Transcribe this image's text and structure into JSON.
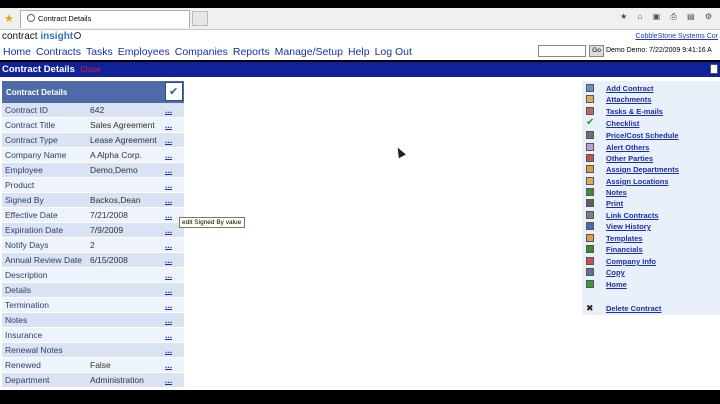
{
  "browser": {
    "tab_title": "Contract Details"
  },
  "header": {
    "brand_part1": "contract",
    "brand_part2": "insight",
    "company_link": "CobbleStone Systems Cor"
  },
  "nav": {
    "items": [
      "Home",
      "Contracts",
      "Tasks",
      "Employees",
      "Companies",
      "Reports",
      "Manage/Setup",
      "Help",
      "Log Out"
    ],
    "go_label": "Go",
    "search_placeholder": "",
    "demo_info": "Demo Demo: 7/22/2009 9:41:16 A"
  },
  "page": {
    "title": "Contract Details",
    "close_label": "Close"
  },
  "details": {
    "header": "Contract Details",
    "rows": [
      {
        "label": "Contract ID",
        "value": "642"
      },
      {
        "label": "Contract Title",
        "value": "Sales Agreement"
      },
      {
        "label": "Contract Type",
        "value": "Lease Agreement"
      },
      {
        "label": "Company Name",
        "value": "A Alpha Corp."
      },
      {
        "label": "Employee",
        "value": "Demo,Demo"
      },
      {
        "label": "Product",
        "value": ""
      },
      {
        "label": "Signed By",
        "value": "Backos,Dean"
      },
      {
        "label": "Effective Date",
        "value": "7/21/2008"
      },
      {
        "label": "Expiration Date",
        "value": "7/9/2009"
      },
      {
        "label": "Notify Days",
        "value": "2"
      },
      {
        "label": "Annual Review Date",
        "value": "6/15/2008"
      },
      {
        "label": "Description",
        "value": ""
      },
      {
        "label": "Details",
        "value": ""
      },
      {
        "label": "Termination",
        "value": ""
      },
      {
        "label": "Notes",
        "value": ""
      },
      {
        "label": "Insurance",
        "value": ""
      },
      {
        "label": "Renewal Notes",
        "value": ""
      },
      {
        "label": "Renewed",
        "value": "False"
      },
      {
        "label": "Department",
        "value": "Administration"
      }
    ],
    "edit_dots": "...",
    "tooltip": "edit Signed By value"
  },
  "actions": {
    "items": [
      {
        "label": "Add Contract",
        "icon": "add-document-icon",
        "color": "#6b8cc8"
      },
      {
        "label": "Attachments",
        "icon": "paperclip-icon",
        "color": "#d8b060"
      },
      {
        "label": "Tasks & E-mails",
        "icon": "task-icon",
        "color": "#c86060"
      },
      {
        "label": "Checklist",
        "icon": "checkmark-icon",
        "color": "#2a9a2a"
      },
      {
        "label": "Price/Cost Schedule",
        "icon": "calculator-icon",
        "color": "#707070"
      },
      {
        "label": "Alert Others",
        "icon": "alert-icon",
        "color": "#c0a0d0"
      },
      {
        "label": "Other Parties",
        "icon": "people-icon",
        "color": "#c85050"
      },
      {
        "label": "Assign Departments",
        "icon": "pencil-icon",
        "color": "#d8a040"
      },
      {
        "label": "Assign Locations",
        "icon": "folder-icon",
        "color": "#e0b050"
      },
      {
        "label": "Notes",
        "icon": "note-icon",
        "color": "#3a8a3a"
      },
      {
        "label": "Print",
        "icon": "printer-icon",
        "color": "#606060"
      },
      {
        "label": "Link Contracts",
        "icon": "link-icon",
        "color": "#808080"
      },
      {
        "label": "View History",
        "icon": "history-icon",
        "color": "#4a6ab0"
      },
      {
        "label": "Templates",
        "icon": "template-icon",
        "color": "#e0a040"
      },
      {
        "label": "Financials",
        "icon": "financials-icon",
        "color": "#3a8a3a"
      },
      {
        "label": "Company Info",
        "icon": "company-icon",
        "color": "#c85050"
      },
      {
        "label": "Copy",
        "icon": "copy-icon",
        "color": "#6070a0"
      },
      {
        "label": "Home",
        "icon": "home-icon",
        "color": "#3a9a3a"
      },
      {
        "label": "Delete Contract",
        "icon": "delete-icon",
        "color": "#222222"
      }
    ]
  }
}
